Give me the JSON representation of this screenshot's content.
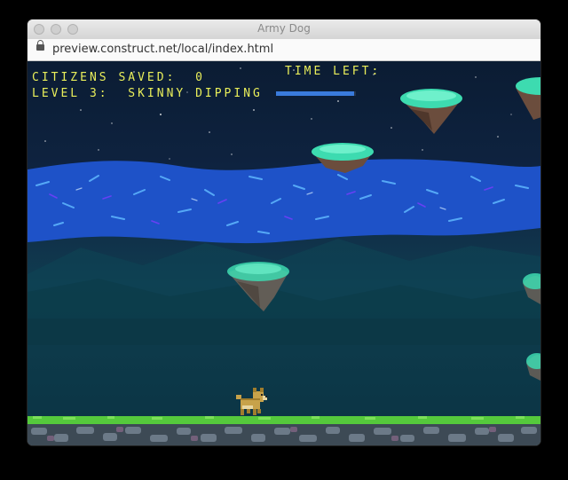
{
  "window": {
    "title": "Army Dog",
    "url": "preview.construct.net/local/index.html"
  },
  "hud": {
    "citizens_label": "CITIZENS SAVED:",
    "citizens_value": "0",
    "level_label": "LEVEL 3:",
    "level_name": "SKINNY DIPPING",
    "time_label": "TIME LEFT:",
    "time_left_fraction": 0.98
  },
  "colors": {
    "hud_text": "#e9ee5a",
    "water": "#1e52c8",
    "grass": "#55c93c",
    "island_top": "#3ddbb0"
  }
}
